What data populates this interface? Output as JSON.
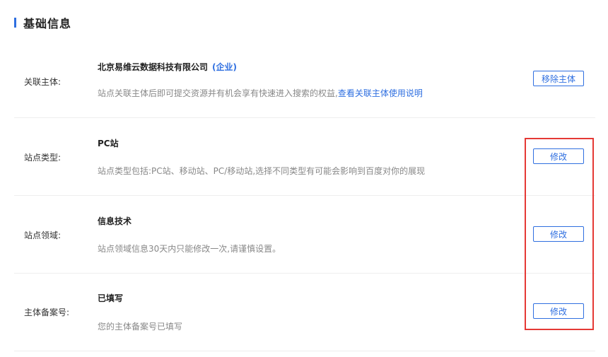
{
  "section": {
    "title": "基础信息"
  },
  "rows": [
    {
      "label": "关联主体:",
      "title": "北京易维云数据科技有限公司",
      "tag": "(企业)",
      "desc": "站点关联主体后即可提交资源并有机会享有快速进入搜索的权益,",
      "desc_link": "查看关联主体使用说明",
      "button": "移除主体"
    },
    {
      "label": "站点类型:",
      "title": "PC站",
      "desc": "站点类型包括:PC站、移动站、PC/移动站,选择不同类型有可能会影响到百度对你的展现",
      "button": "修改"
    },
    {
      "label": "站点领域:",
      "title": "信息技术",
      "desc": "站点领域信息30天内只能修改一次,请谨慎设置。",
      "button": "修改"
    },
    {
      "label": "主体备案号:",
      "title": "已填写",
      "desc": "您的主体备案号已填写",
      "button": "修改"
    }
  ],
  "colors": {
    "accent": "#2f6fe0",
    "highlight": "#e53935"
  }
}
